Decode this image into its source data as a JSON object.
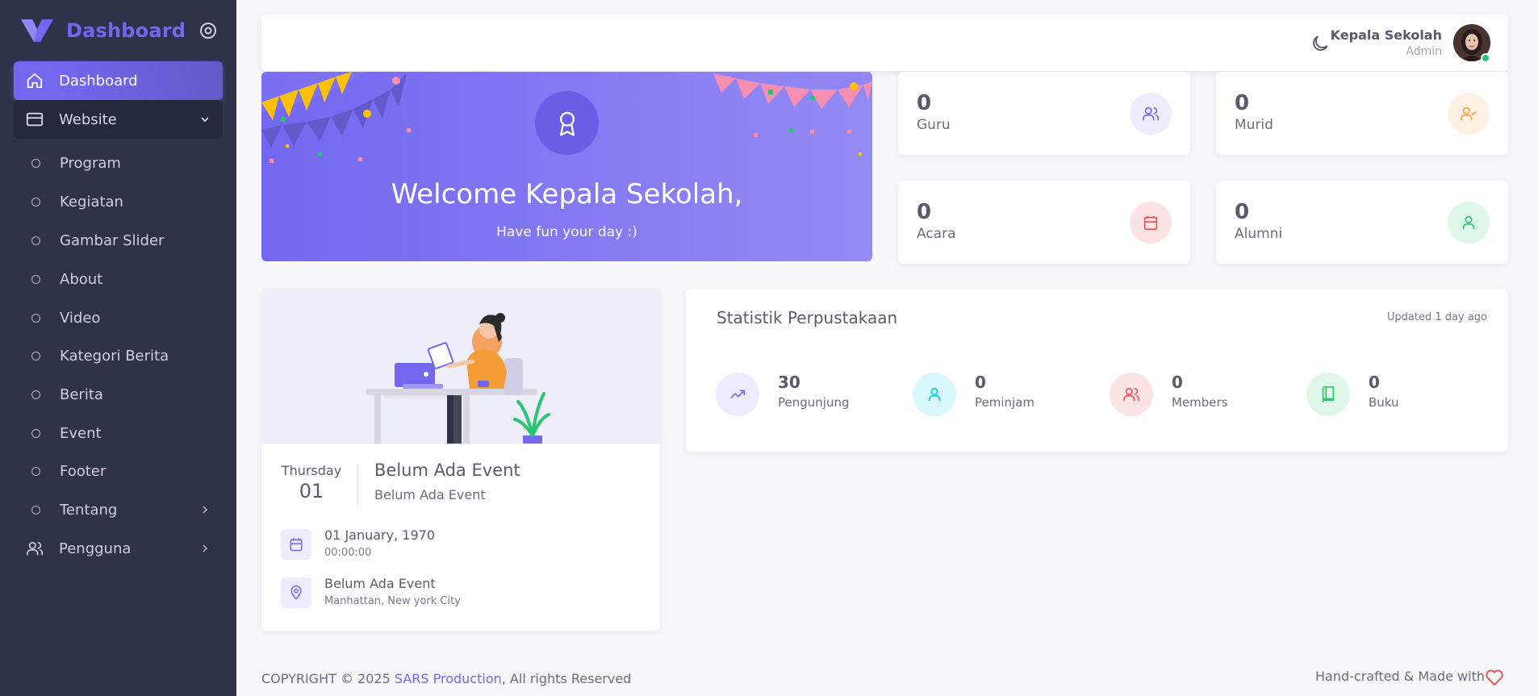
{
  "brand": {
    "name": "Dashboard",
    "logo_icon": "vuexy-logo-icon",
    "accent": "#7367f0"
  },
  "sidebar": {
    "items": [
      {
        "label": "Dashboard",
        "icon": "home-icon",
        "state": "active"
      },
      {
        "label": "Website",
        "icon": "layout-icon",
        "state": "open"
      }
    ],
    "sub_items": [
      {
        "label": "Program"
      },
      {
        "label": "Kegiatan"
      },
      {
        "label": "Gambar Slider"
      },
      {
        "label": "About"
      },
      {
        "label": "Video"
      },
      {
        "label": "Kategori Berita"
      },
      {
        "label": "Berita"
      },
      {
        "label": "Event"
      },
      {
        "label": "Footer"
      },
      {
        "label": "Tentang"
      }
    ],
    "users": {
      "label": "Pengguna",
      "icon": "users-icon"
    }
  },
  "navbar": {
    "user_name": "Kepala Sekolah",
    "user_role": "Admin",
    "theme_icon": "moon-icon",
    "status_color": "#28c76f"
  },
  "welcome": {
    "title": "Welcome Kepala Sekolah,",
    "subtitle": "Have fun your day :)",
    "icon": "award-icon"
  },
  "stats": [
    {
      "value": "0",
      "label": "Guru",
      "icon": "users-icon",
      "color": "#7367f0"
    },
    {
      "value": "0",
      "label": "Murid",
      "icon": "user-check-icon",
      "color": "#ff9f43"
    },
    {
      "value": "0",
      "label": "Acara",
      "icon": "calendar-icon",
      "color": "#ea5455"
    },
    {
      "value": "0",
      "label": "Alumni",
      "icon": "user-icon",
      "color": "#28c76f"
    }
  ],
  "event": {
    "day": "Thursday",
    "date": "01",
    "title": "Belum Ada Event",
    "description": "Belum Ada Event",
    "date_full": "01 January, 1970",
    "time": "00:00:00",
    "location_title": "Belum Ada Event",
    "location": "Manhattan, New york City"
  },
  "library": {
    "title": "Statistik Perpustakaan",
    "updated": "Updated 1 day ago",
    "items": [
      {
        "value": "30",
        "label": "Pengunjung",
        "icon": "trending-up-icon",
        "color": "#7367f0"
      },
      {
        "value": "0",
        "label": "Peminjam",
        "icon": "user-icon",
        "color": "#00cfe8"
      },
      {
        "value": "0",
        "label": "Members",
        "icon": "users-icon",
        "color": "#ea5455"
      },
      {
        "value": "0",
        "label": "Buku",
        "icon": "book-icon",
        "color": "#28c76f"
      }
    ]
  },
  "footer": {
    "copyright_prefix": "COPYRIGHT © 2025 ",
    "company": "SARS Production",
    "copyright_suffix": ", All rights Reserved",
    "crafted": "Hand-crafted & Made with",
    "heart_icon": "heart-icon"
  }
}
